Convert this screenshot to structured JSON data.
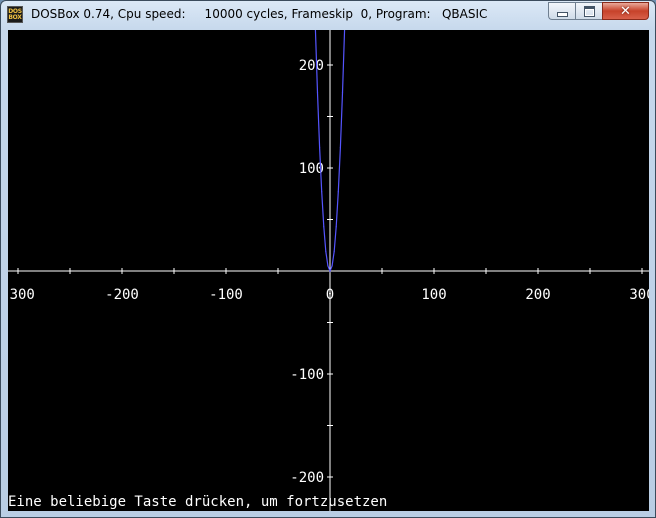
{
  "window": {
    "title": "DOSBox 0.74, Cpu speed:     10000 cycles, Frameskip  0, Program:   QBASIC",
    "icon_text": [
      "DOS",
      "BOX"
    ],
    "close_glyph": "✕"
  },
  "screen": {
    "prompt": "Eine beliebige Taste drücken, um fortzusetzen"
  },
  "chart_data": {
    "type": "line",
    "title": "",
    "xlabel": "",
    "ylabel": "",
    "xlim": [
      -310,
      310
    ],
    "ylim": [
      -200,
      240
    ],
    "x_ticks": [
      -300,
      -200,
      -100,
      0,
      100,
      200,
      300
    ],
    "y_ticks": [
      200,
      100,
      -100,
      -200
    ],
    "x_tick_labels": [
      "-300",
      "-200",
      "-100",
      "0",
      "100",
      "200",
      "300"
    ],
    "y_tick_labels": [
      "200",
      "100",
      "-100",
      "-200"
    ],
    "grid": false,
    "axis_color": "#ffffff",
    "series": [
      {
        "color": "#5555ff",
        "x": [
          -14,
          -12,
          -10,
          -8,
          -6,
          -4,
          -2,
          0,
          2,
          4,
          6,
          8,
          10,
          12,
          14
        ],
        "y": [
          235,
          173,
          120,
          77,
          43,
          19,
          5,
          0,
          5,
          19,
          43,
          77,
          120,
          173,
          235
        ]
      }
    ]
  }
}
